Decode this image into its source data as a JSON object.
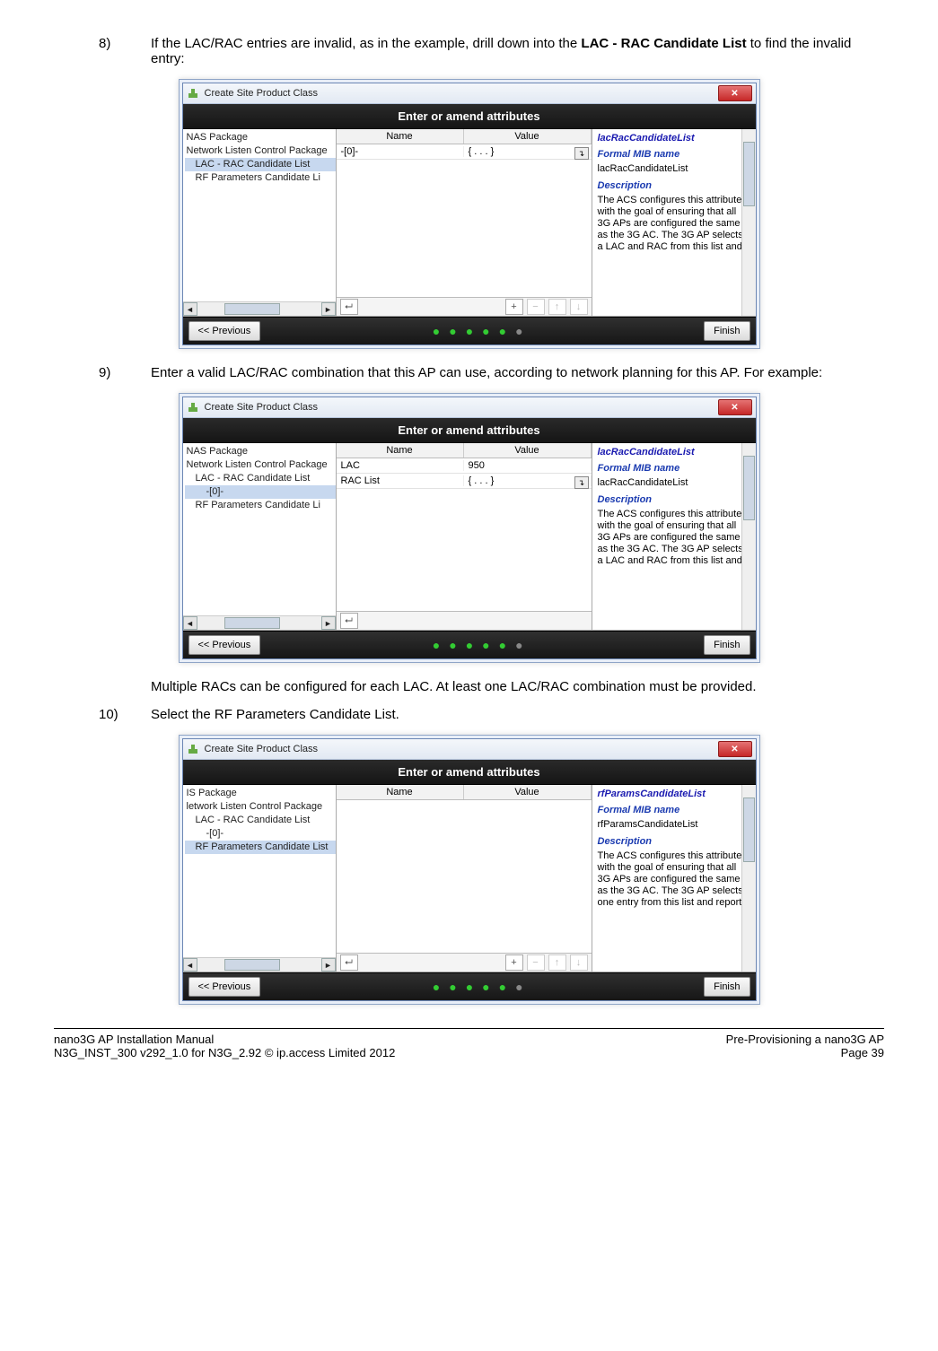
{
  "steps": {
    "s8": {
      "num": "8)",
      "text_a": "If the LAC/RAC entries are invalid, as in the example, drill down into the ",
      "bold": "LAC - RAC Candidate List",
      "text_b": " to find the invalid entry:"
    },
    "s9": {
      "num": "9)",
      "text": "Enter a valid LAC/RAC combination that this AP can use, according to network planning for this AP. For example:"
    },
    "note9": "Multiple RACs can be configured for each LAC. At least one LAC/RAC combination must be provided.",
    "s10": {
      "num": "10)",
      "text": "Select the RF Parameters Candidate List."
    }
  },
  "dialog": {
    "title": "Create Site Product Class",
    "banner": "Enter or amend attributes",
    "prev": "<< Previous",
    "finish": "Finish",
    "grid_headers": {
      "name": "Name",
      "value": "Value"
    }
  },
  "tree_a": {
    "r1": "NAS Package",
    "r2": "Network Listen Control Package",
    "r3": "LAC - RAC Candidate List",
    "r4": "RF Parameters Candidate Li"
  },
  "tree_b": {
    "r1": "NAS Package",
    "r2": "Network Listen Control Package",
    "r3": "LAC - RAC Candidate List",
    "r4": "-[0]-",
    "r5": "RF Parameters Candidate Li"
  },
  "tree_c": {
    "r1": "IS Package",
    "r2": "letwork Listen Control Package",
    "r3": "LAC - RAC Candidate List",
    "r4": "-[0]-",
    "r5": "RF Parameters Candidate List"
  },
  "grid_a": {
    "r1_name": "-[0]-",
    "r1_val": "{ . . . }"
  },
  "grid_b": {
    "r1_name": "LAC",
    "r1_val": "950",
    "r2_name": "RAC List",
    "r2_val": "{ . . . }"
  },
  "info_lac": {
    "title": "lacRacCandidateList",
    "sect1": "Formal MIB name",
    "val1": "lacRacCandidateList",
    "sect2": "Description",
    "desc": "The ACS configures this attribute with the goal of ensuring that all 3G APs are configured the same as the 3G AC. The 3G AP selects a LAC and RAC from this list and"
  },
  "info_rf": {
    "title": "rfParamsCandidateList",
    "sect1": "Formal MIB name",
    "val1": "rfParamsCandidateList",
    "sect2": "Description",
    "desc": "The ACS configures this attribute with the goal of ensuring that all 3G APs are configured the same as the 3G AC. The 3G AP selects one entry from this list and reports"
  },
  "toolbar": {
    "up": "⮠",
    "plus": "+",
    "minus": "−",
    "arrUp": "↑",
    "arrDn": "↓"
  },
  "footer": {
    "l1": "nano3G AP Installation Manual",
    "l2": "N3G_INST_300 v292_1.0 for N3G_2.92 © ip.access Limited 2012",
    "r1": "Pre-Provisioning a nano3G AP",
    "r2": "Page 39"
  }
}
